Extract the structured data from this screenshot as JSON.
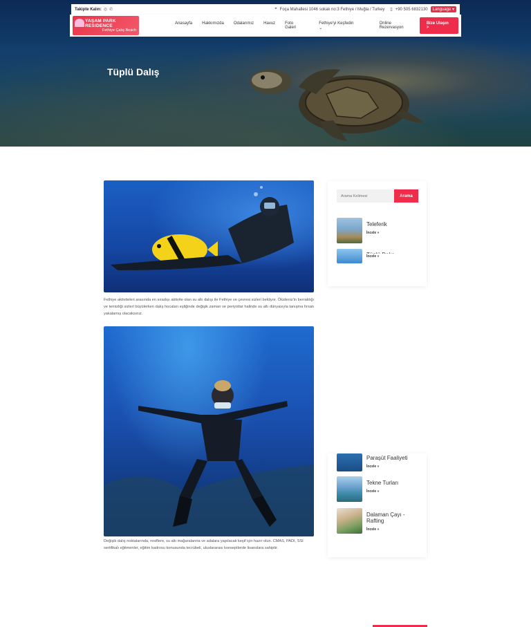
{
  "hero": {
    "title": "Tüplü Dalış"
  },
  "topbar": {
    "follow_label": "Takipte Kalın:",
    "address": "Foça Mahallesi 1046 sokak no:3 Fethiye / Muğla / Turkey",
    "phone": "+90 505 6832130",
    "language_label": "Language"
  },
  "logo": {
    "line1": "YAŞAM PARK RESIDENCE",
    "line2": "Fethiye Çalış Beach"
  },
  "nav": {
    "items": [
      "Anasayfa",
      "Hakkımızda",
      "Odalarımız",
      "Havuz",
      "Foto Galeri",
      "Fethiye'yi Keşfedin",
      "Online Rezervasyon"
    ],
    "cta": "Bize Ulaşın >"
  },
  "content": {
    "paragraph1": "Fethiye aktiviteleri arasında en sıradışı aktivite olan su altı dalışı ile Fethiye ve çevresi sizleri bekliyor. Ölüdeniz'in berraklığı ve temizliği sizleri büyülerken dalış hocaları eşliğinde değişik zaman ve periyotlar halinde su altı dünyasıyla tanışma fırsatı yakalamış olacaksınız.",
    "paragraph2": "Değişik dalış noktalarında, resiflere, su altı mağaralarına ve adalara yapılacak keşif için hazır olun. CMAS, PADI, SSI sertifikalı eğitmenler, eğitim kadrosu konusunda tecrübeli, uluslararası konseptlerde lisanslara sahiptir."
  },
  "sidebar": {
    "search_placeholder": "Arama Kelimesi",
    "search_button": "Arama",
    "items_top": [
      {
        "title": "Teleferik",
        "more": "İncele »"
      },
      {
        "title": "Tüplü Dalış",
        "more": "İncele »"
      }
    ],
    "items_bottom": [
      {
        "title": "Paraşüt Faaliyeti",
        "more": "İncele »"
      },
      {
        "title": "Tekne Turları",
        "more": "İncele »"
      },
      {
        "title": "Dalaman Çayı - Rafting",
        "more": "İncele »"
      }
    ]
  },
  "colors": {
    "accent": "#ef2d4b",
    "sea": "#1a4fae"
  }
}
